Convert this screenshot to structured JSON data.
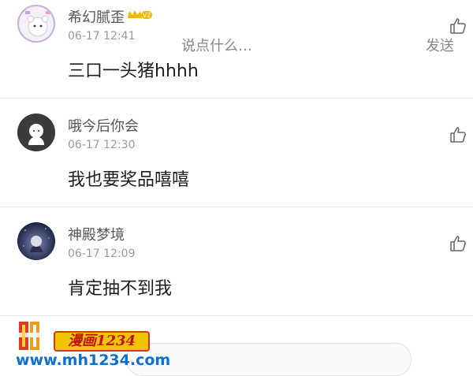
{
  "comments": [
    {
      "username": "希幻腻歪",
      "vip_badge": "V2",
      "time": "06-17 12:41",
      "text": "三口一头猪hhhh"
    },
    {
      "username": "哦今后你会",
      "time": "06-17 12:30",
      "text": "我也要奖品嘻嘻"
    },
    {
      "username": "神殿梦境",
      "time": "06-17 12:09",
      "text": "肯定抽不到我"
    }
  ],
  "watermark": {
    "badge_text": "漫画1234",
    "url_text": "www.mh1234.com"
  },
  "bottom_bar": {
    "input_hint": "说点什么…",
    "send_hint": "发送"
  },
  "colors": {
    "name": "#555555",
    "time": "#9a9a9a",
    "divider": "#e9e9e9",
    "watermark_url": "#0c6fd1",
    "watermark_badge_bg": "#f0c400"
  }
}
